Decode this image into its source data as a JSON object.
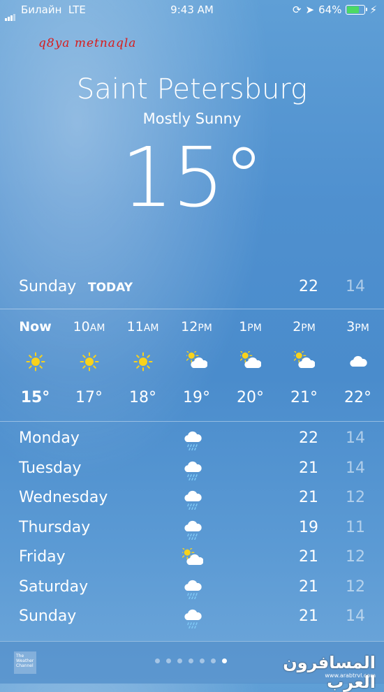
{
  "status_bar": {
    "carrier": "Билайн",
    "network": "LTE",
    "time": "9:43 AM",
    "battery": "64%"
  },
  "watermark": "q8ya metnaqla",
  "location": {
    "city": "Saint Petersburg",
    "condition": "Mostly Sunny",
    "temperature": "15°"
  },
  "today": {
    "day": "Sunday",
    "label": "TODAY",
    "high": "22",
    "low": "14"
  },
  "hourly": [
    {
      "time": "Now",
      "suffix": "",
      "icon": "sun-icon",
      "temp": "15°"
    },
    {
      "time": "10",
      "suffix": "AM",
      "icon": "sun-icon",
      "temp": "17°"
    },
    {
      "time": "11",
      "suffix": "AM",
      "icon": "sun-icon",
      "temp": "18°"
    },
    {
      "time": "12",
      "suffix": "PM",
      "icon": "partly-sunny-icon",
      "temp": "19°"
    },
    {
      "time": "1",
      "suffix": "PM",
      "icon": "partly-sunny-icon",
      "temp": "20°"
    },
    {
      "time": "2",
      "suffix": "PM",
      "icon": "partly-sunny-icon",
      "temp": "21°"
    },
    {
      "time": "3",
      "suffix": "PM",
      "icon": "cloud-icon",
      "temp": "22°"
    }
  ],
  "daily": [
    {
      "day": "Monday",
      "icon": "rain-cloud-icon",
      "high": "22",
      "low": "14"
    },
    {
      "day": "Tuesday",
      "icon": "rain-cloud-icon",
      "high": "21",
      "low": "14"
    },
    {
      "day": "Wednesday",
      "icon": "rain-cloud-icon",
      "high": "21",
      "low": "12"
    },
    {
      "day": "Thursday",
      "icon": "rain-cloud-icon",
      "high": "19",
      "low": "11"
    },
    {
      "day": "Friday",
      "icon": "partly-sunny-icon",
      "high": "21",
      "low": "12"
    },
    {
      "day": "Saturday",
      "icon": "rain-cloud-icon",
      "high": "21",
      "low": "12"
    },
    {
      "day": "Sunday",
      "icon": "rain-cloud-icon",
      "high": "21",
      "low": "14"
    }
  ],
  "footer": {
    "provider": "The Weather Channel",
    "page_count": 7,
    "active_page": 7,
    "logo_text": "المسافرون العرب",
    "logo_url": "www.arabtrvl.com"
  },
  "colors": {
    "sky_top": "#5f9fd6",
    "sky_bottom": "#6ea7da",
    "battery_green": "#4cd964",
    "watermark_red": "#d91b1b",
    "sun_yellow": "#f8d21c"
  }
}
